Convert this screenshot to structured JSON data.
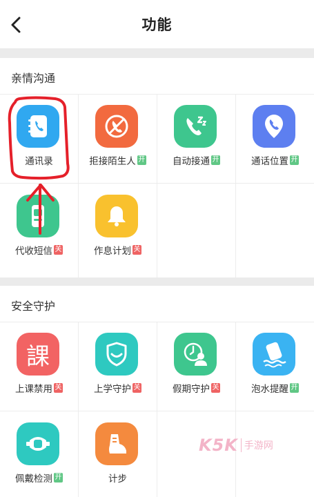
{
  "header": {
    "title": "功能",
    "back_icon": "chevron-left-icon"
  },
  "sections": [
    {
      "title": "亲情沟通",
      "items": [
        {
          "label": "通讯录",
          "icon": "contacts-book-icon",
          "color": "#30a8f0",
          "badge": ""
        },
        {
          "label": "拒接陌生人",
          "icon": "phone-block-icon",
          "color": "#f26a3f",
          "badge": "开"
        },
        {
          "label": "自动接通",
          "icon": "phone-auto-icon",
          "color": "#3ec68e",
          "badge": "开"
        },
        {
          "label": "通话位置",
          "icon": "phone-location-icon",
          "color": "#5d7ff0",
          "badge": "开"
        },
        {
          "label": "代收短信",
          "icon": "sms-phone-icon",
          "color": "#3ec68e",
          "badge": "关"
        },
        {
          "label": "作息计划",
          "icon": "bell-icon",
          "color": "#f9c12e",
          "badge": "关"
        }
      ]
    },
    {
      "title": "安全守护",
      "items": [
        {
          "label": "上课禁用",
          "icon": "class-icon",
          "color": "#f26363",
          "badge": "关",
          "glyph": "課"
        },
        {
          "label": "上学守护",
          "icon": "shield-icon",
          "color": "#2ec9c0",
          "badge": "关"
        },
        {
          "label": "假期守护",
          "icon": "holiday-guard-icon",
          "color": "#3ec68e",
          "badge": "关"
        },
        {
          "label": "泡水提醒",
          "icon": "water-alert-icon",
          "color": "#3ab3f2",
          "badge": "开"
        },
        {
          "label": "佩戴检测",
          "icon": "wear-detect-icon",
          "color": "#2ec9c0",
          "badge": "开"
        },
        {
          "label": "计步",
          "icon": "footstep-icon",
          "color": "#f48a3e",
          "badge": ""
        }
      ]
    }
  ],
  "watermark": {
    "logo": "K5K",
    "text": "手游网"
  },
  "colors": {
    "badge_on": "#60c785",
    "badge_off": "#ef6363",
    "annotation": "#e5202a"
  }
}
